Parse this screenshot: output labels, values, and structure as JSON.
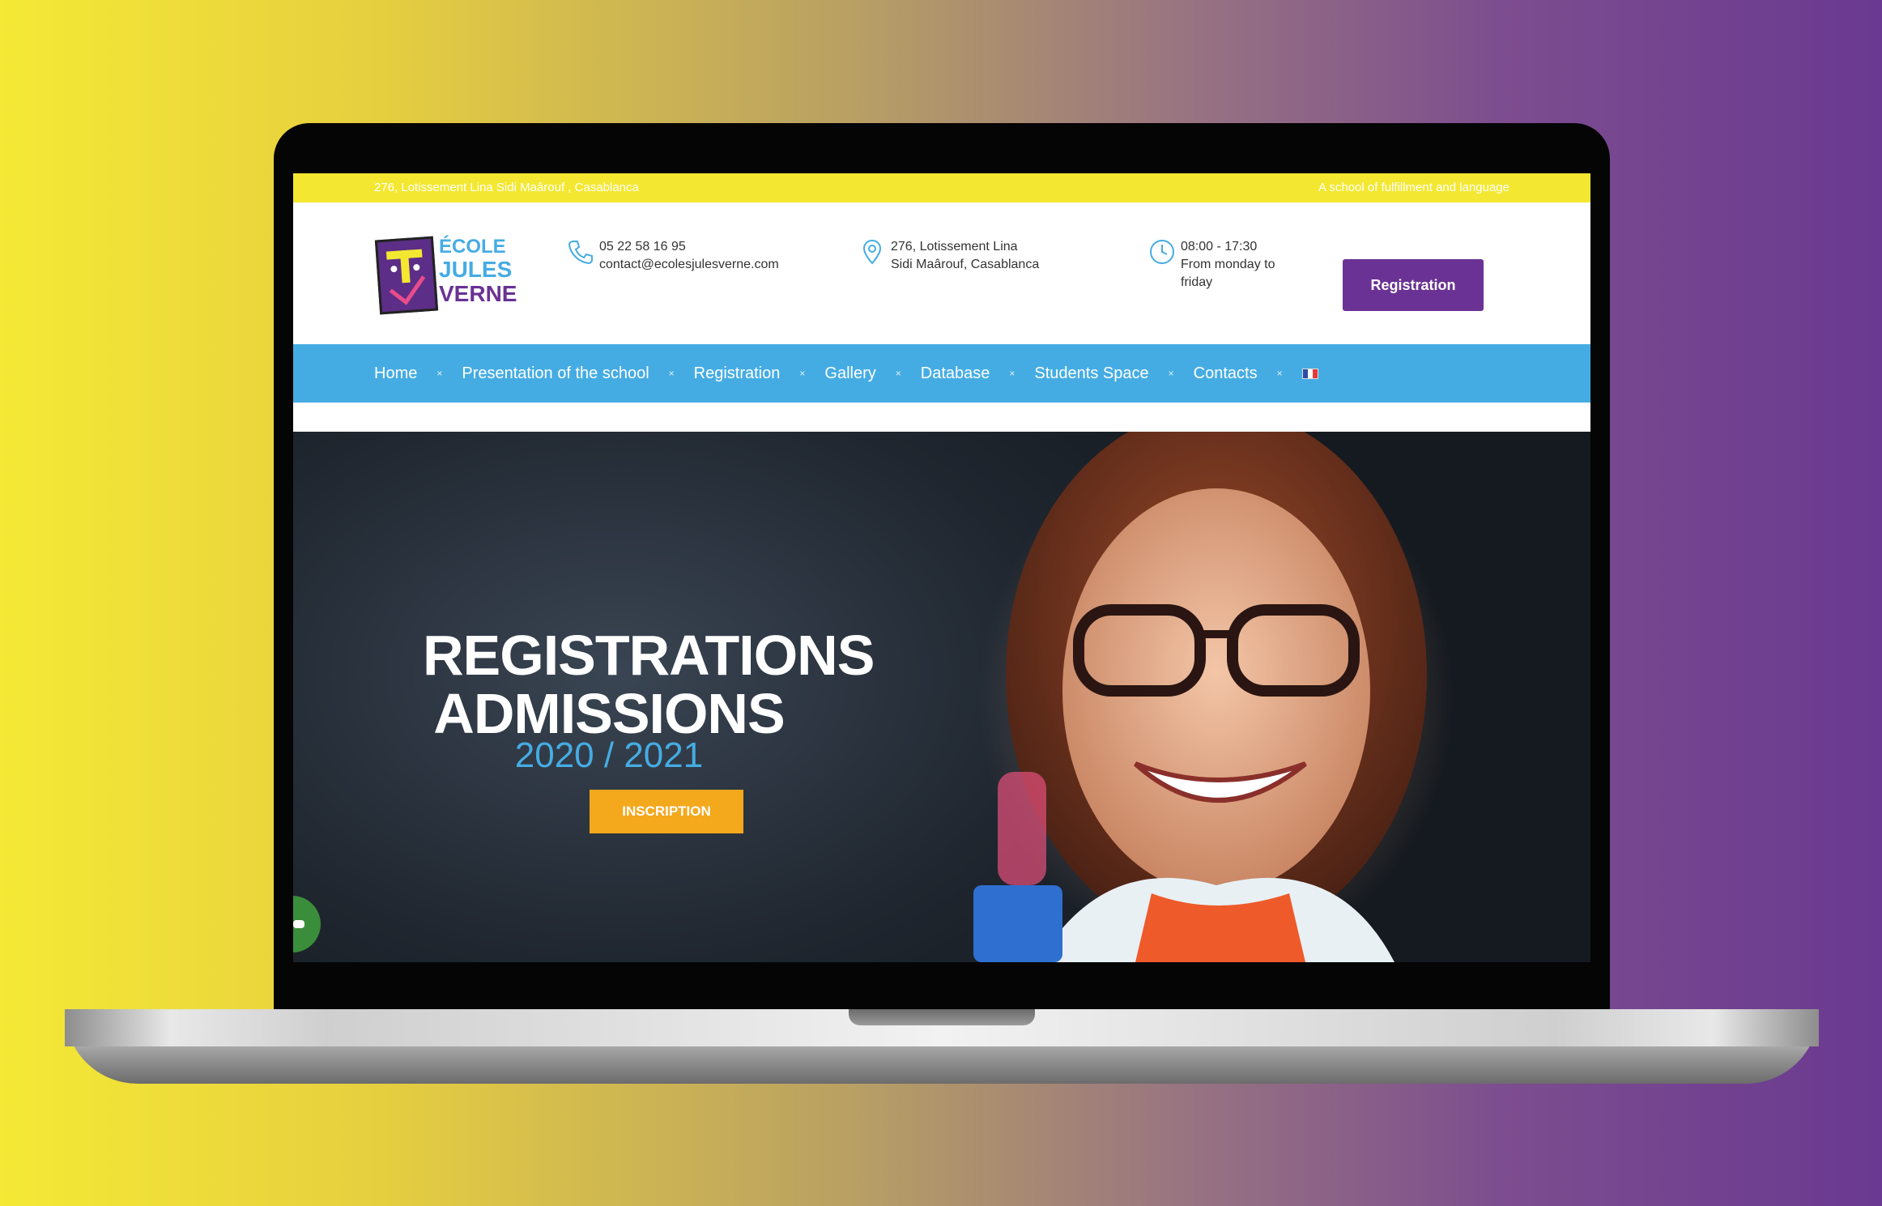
{
  "topbar": {
    "address": "276, Lotissement Lina Sidi Maârouf , Casablanca",
    "tagline": "A school of fulfillment and language"
  },
  "logo": {
    "line1": "ÉCOLE",
    "line2": "JULES",
    "line3": "VERNE"
  },
  "contacts": {
    "phone": "05 22 58 16 95",
    "email": "contact@ecolesjulesverne.com",
    "address_line1": "276, Lotissement Lina",
    "address_line2": "Sidi Maârouf, Casablanca",
    "hours": "08:00 - 17:30",
    "days_line1": "From monday to",
    "days_line2": "friday"
  },
  "header": {
    "registration_label": "Registration"
  },
  "nav": {
    "items": [
      {
        "label": "Home"
      },
      {
        "label": "Presentation of the school"
      },
      {
        "label": "Registration"
      },
      {
        "label": "Gallery"
      },
      {
        "label": "Database"
      },
      {
        "label": "Students Space"
      },
      {
        "label": "Contacts"
      }
    ],
    "separator": "×"
  },
  "hero": {
    "title_line1": "REGISTRATIONS",
    "title_line2": "ADMISSIONS",
    "year": "2020 / 2021",
    "button_label": "INSCRIPTION"
  },
  "colors": {
    "topbar": "#f4e731",
    "nav": "#45ace3",
    "registration_button": "#6a3294",
    "inscription_button": "#f4a81c",
    "year": "#45ace3"
  },
  "icons": {
    "phone": "phone-icon",
    "location": "location-pin-icon",
    "clock": "clock-icon",
    "flag": "french-flag-icon",
    "chat": "chat-icon"
  }
}
